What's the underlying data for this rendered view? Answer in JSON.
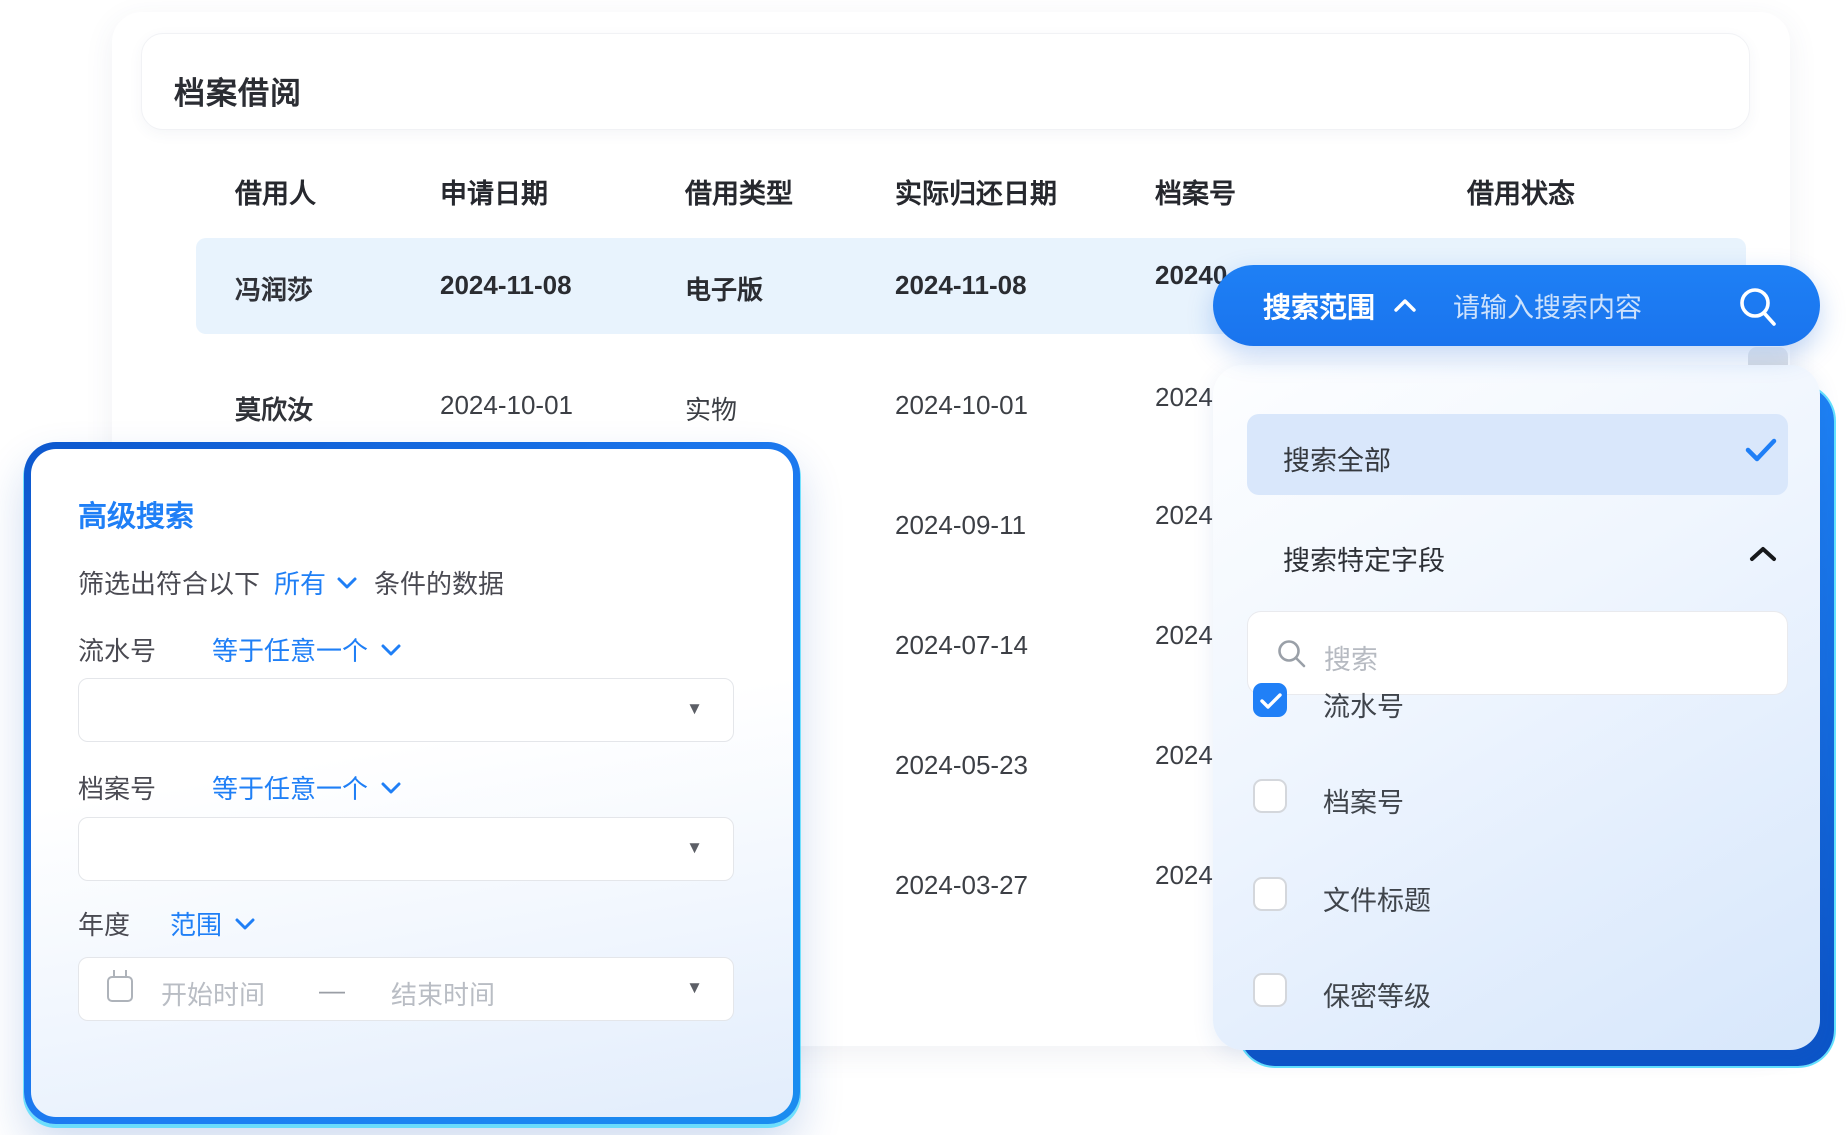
{
  "page": {
    "title": "档案借阅"
  },
  "table": {
    "columns": [
      "借用人",
      "申请日期",
      "借用类型",
      "实际归还日期",
      "档案号",
      "借用状态"
    ],
    "rows": [
      {
        "borrower": "冯润莎",
        "apply_date": "2024-11-08",
        "type": "电子版",
        "return_date": "2024-11-08",
        "archive_no": "20240"
      },
      {
        "borrower": "莫欣汝",
        "apply_date": "2024-10-01",
        "type": "实物",
        "return_date": "2024-10-01",
        "archive_no": "2024"
      },
      {
        "return_date": "2024-09-11",
        "archive_no": "2024"
      },
      {
        "return_date": "2024-07-14",
        "archive_no": "2024"
      },
      {
        "return_date": "2024-05-23",
        "archive_no": "2024"
      },
      {
        "return_date": "2024-03-27",
        "archive_no": "2024"
      }
    ]
  },
  "search_bar": {
    "scope_label": "搜索范围",
    "placeholder": "请输入搜索内容"
  },
  "scope_panel": {
    "all_option": "搜索全部",
    "specific_label": "搜索特定字段",
    "field_search_placeholder": "搜索",
    "fields": [
      {
        "label": "流水号",
        "checked": true
      },
      {
        "label": "档案号",
        "checked": false
      },
      {
        "label": "文件标题",
        "checked": false
      },
      {
        "label": "保密等级",
        "checked": false
      }
    ]
  },
  "advanced_panel": {
    "title": "高级搜索",
    "filter_prefix": "筛选出符合以下",
    "filter_match": "所有",
    "filter_suffix": "条件的数据",
    "conditions": [
      {
        "field": "流水号",
        "operator": "等于任意一个"
      },
      {
        "field": "档案号",
        "operator": "等于任意一个"
      }
    ],
    "year_condition": {
      "field": "年度",
      "operator": "范围",
      "start_placeholder": "开始时间",
      "separator": "—",
      "end_placeholder": "结束时间"
    }
  },
  "colors": {
    "accent_blue": "#1f7ff6",
    "pill_blue": "#1b7bf2",
    "row_highlight": "#e8f3fd",
    "selected_option_bg": "#d9e7fb",
    "border_glow_cyan": "#2fd8ff"
  }
}
